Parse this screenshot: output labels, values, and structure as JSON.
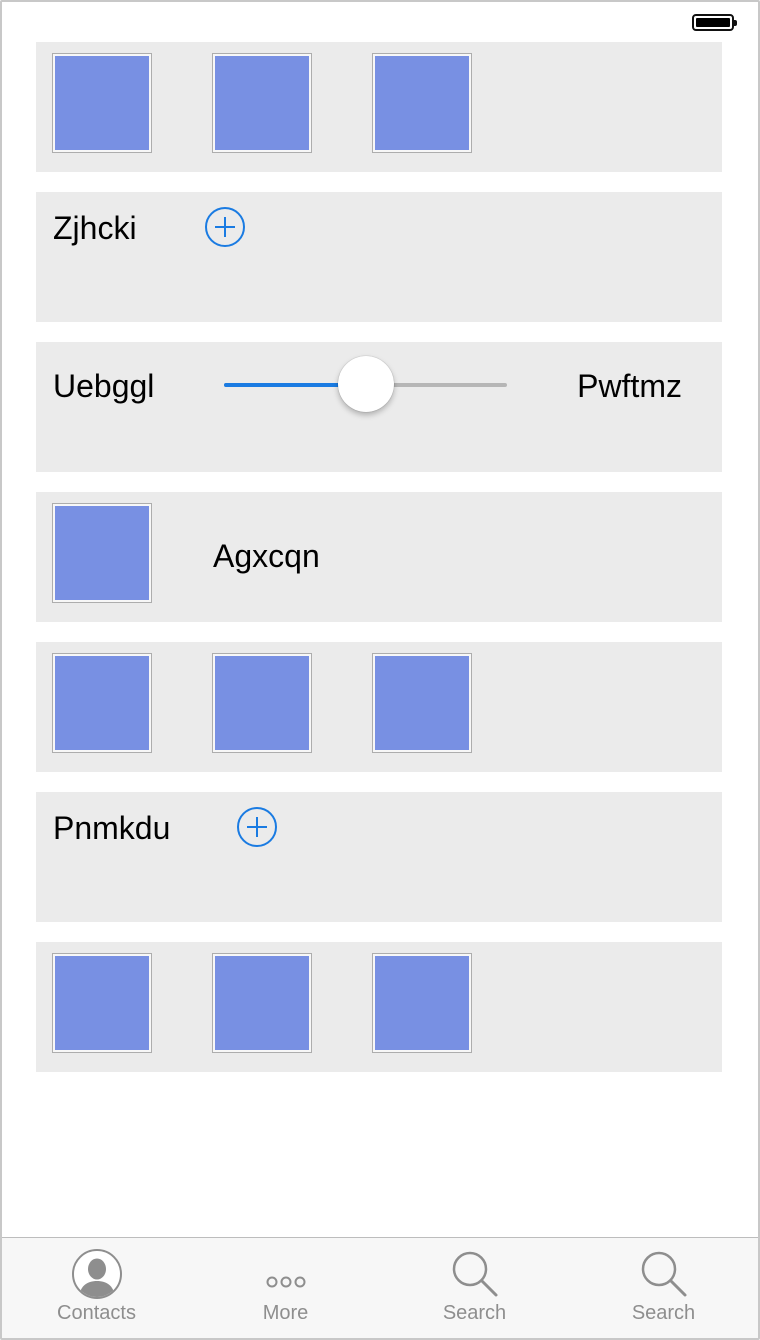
{
  "status_bar": {
    "battery_icon": "battery-full-icon"
  },
  "rows": [
    {
      "type": "image-row",
      "images": [
        "image-placeholder",
        "image-placeholder",
        "image-placeholder"
      ]
    },
    {
      "type": "label-add",
      "label": "Zjhcki",
      "icon": "add-circle-icon"
    },
    {
      "type": "slider",
      "left_label": "Uebggl",
      "right_label": "Pwftmz",
      "value": 0.5
    },
    {
      "type": "image-label",
      "label": "Agxcqn"
    },
    {
      "type": "image-row",
      "images": [
        "image-placeholder",
        "image-placeholder",
        "image-placeholder"
      ]
    },
    {
      "type": "label-add",
      "label": "Pnmkdu",
      "icon": "add-circle-icon"
    },
    {
      "type": "image-row",
      "images": [
        "image-placeholder",
        "image-placeholder",
        "image-placeholder"
      ]
    }
  ],
  "tab_bar": {
    "tabs": [
      {
        "label": "Contacts",
        "icon": "contact-person-icon"
      },
      {
        "label": "More",
        "icon": "more-dots-icon"
      },
      {
        "label": "Search",
        "icon": "search-icon"
      },
      {
        "label": "Search",
        "icon": "search-icon"
      }
    ]
  },
  "colors": {
    "accent": "#1a7be2",
    "row_background": "#ebebeb",
    "image_fill": "#7890e3",
    "tab_label": "#8e8e8e"
  }
}
